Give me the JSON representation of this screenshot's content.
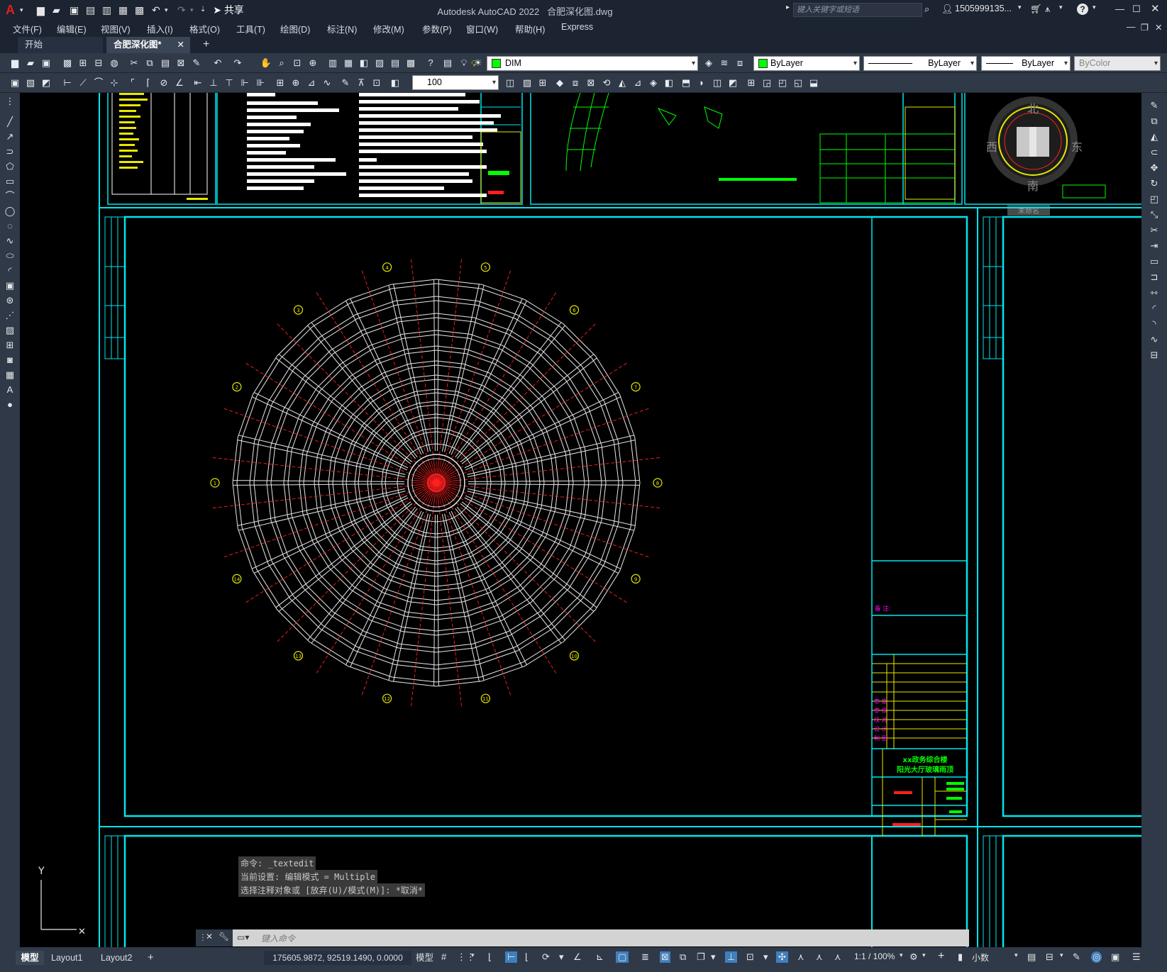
{
  "app": {
    "title": "Autodesk AutoCAD 2022",
    "filename": "合肥深化图.dwg",
    "share_label": "共享",
    "search_placeholder": "键入关键字或短语",
    "user": "1505999135...",
    "logo": "A"
  },
  "menu": [
    "文件(F)",
    "编辑(E)",
    "视图(V)",
    "插入(I)",
    "格式(O)",
    "工具(T)",
    "绘图(D)",
    "标注(N)",
    "修改(M)",
    "参数(P)",
    "窗口(W)",
    "帮助(H)",
    "Express"
  ],
  "tabs": {
    "start": "开始",
    "active": "合肥深化图*"
  },
  "toolbar": {
    "layer": "DIM",
    "color": "ByLayer",
    "linetype": "ByLayer",
    "lineweight": "ByLayer",
    "plotstyle": "ByColor",
    "scale": "100"
  },
  "compass": {
    "north": "北",
    "south": "南",
    "east": "东",
    "west": "西",
    "ucs": "未命名"
  },
  "grid_labels": [
    "1",
    "2",
    "3",
    "4",
    "5",
    "6",
    "7",
    "8",
    "9",
    "10",
    "11",
    "12",
    "13",
    "14"
  ],
  "title_block": {
    "project_line1": "xx政务综合楼",
    "project_line2": "阳光大厅玻璃雨顶",
    "remark": "备 注:",
    "rows": [
      "审 定",
      "审 核",
      "校 对",
      "设 计",
      "制 图"
    ]
  },
  "command_history": [
    "命令: _textedit",
    "当前设置: 编辑模式 = Multiple",
    "选择注释对象或 [放弃(U)/模式(M)]: *取消*"
  ],
  "command_placeholder": "键入命令",
  "axis": {
    "y": "Y"
  },
  "layout_tabs": [
    "模型",
    "Layout1",
    "Layout2"
  ],
  "status": {
    "coords": "175605.9872, 92519.1490, 0.0000",
    "model": "模型",
    "scale": "1:1 / 100%",
    "units": "小数"
  },
  "colors": {
    "cyan": "#00e5ee",
    "red": "#ff2020",
    "yellow": "#e8e800",
    "green": "#00ff00",
    "magenta": "#ff00ff",
    "white": "#e8e8e8"
  }
}
